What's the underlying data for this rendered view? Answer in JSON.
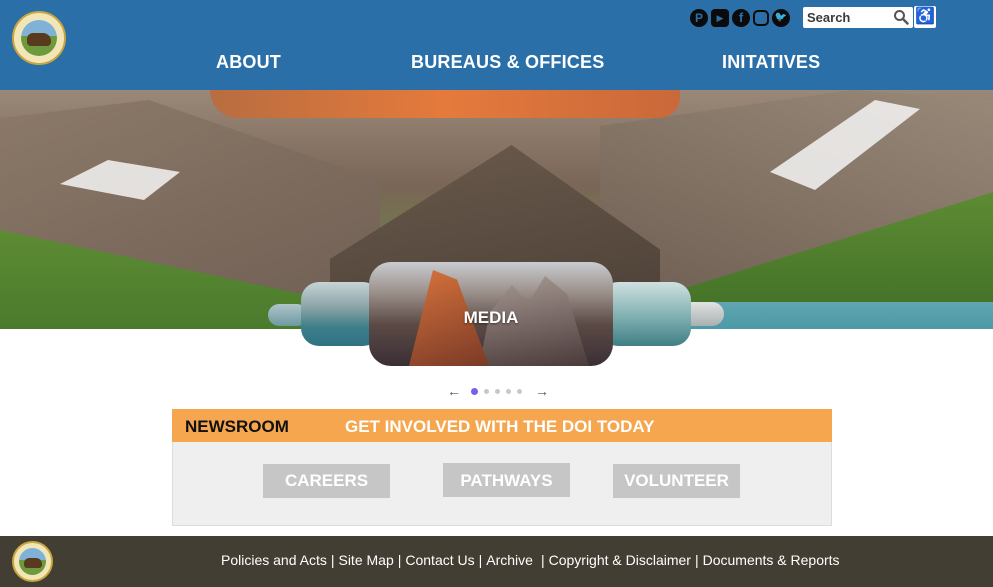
{
  "header": {
    "logo_alt": "U.S. Department of the Interior seal",
    "social_icons": [
      "pinterest-icon",
      "youtube-icon",
      "facebook-icon",
      "instagram-icon",
      "twitter-icon"
    ],
    "search": {
      "placeholder": "Search",
      "value": ""
    },
    "accessibility_icon": "accessibility-icon",
    "nav": [
      {
        "label": "ABOUT"
      },
      {
        "label": "BUREAUS & OFFICES"
      },
      {
        "label": "INITATIVES"
      }
    ]
  },
  "carousel": {
    "active_label": "MEDIA",
    "active_index": 0,
    "slide_count": 5,
    "prev_icon": "arrow-left-icon",
    "next_icon": "arrow-right-icon"
  },
  "newsroom": {
    "title": "NEWSROOM",
    "headline": "GET INVOLVED WITH THE DOI TODAY",
    "buttons": [
      "CAREERS",
      "PATHWAYS",
      "VOLUNTEER"
    ]
  },
  "footer": {
    "links": [
      "Policies and Acts",
      "Site Map",
      "Contact Us",
      "Archive",
      "Copyright & Disclaimer",
      "Documents & Reports"
    ]
  },
  "colors": {
    "header_bg": "#2a6fa8",
    "news_accent": "#f5a64e",
    "footer_bg": "#433e33",
    "dot_active": "#7a5cf0"
  }
}
